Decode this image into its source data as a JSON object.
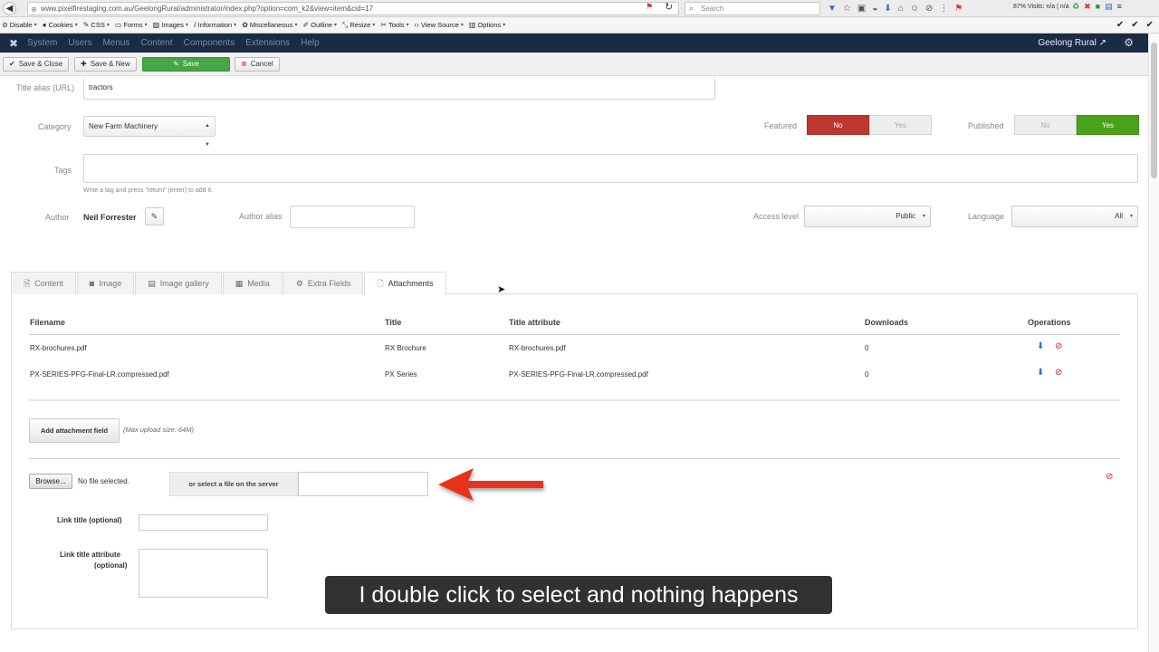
{
  "browser": {
    "url": "www.pixelfirestaging.com.au/GeelongRural/administrator/index.php?option=com_k2&view=item&cid=17",
    "search_placeholder": "Search",
    "visits_text": "87%  Visits: n/a | n/a"
  },
  "dev_toolbar": {
    "items": [
      "Disable",
      "Cookies",
      "CSS",
      "Forms",
      "Images",
      "Information",
      "Miscellaneous",
      "Outline",
      "Resize",
      "Tools",
      "View Source",
      "Options"
    ]
  },
  "admin_nav": {
    "items": [
      "System",
      "Users",
      "Menus",
      "Content",
      "Components",
      "Extensions",
      "Help"
    ],
    "site_link": "Geelong Rural"
  },
  "actions": {
    "save_close": "Save & Close",
    "save_new": "Save & New",
    "save": "Save",
    "cancel": "Cancel"
  },
  "form": {
    "alias_label": "Title alias (URL)",
    "alias_value": "tractors",
    "category_label": "Category",
    "category_value": "New Farm Machinery",
    "featured_label": "Featured",
    "featured_no": "No",
    "featured_yes": "Yes",
    "published_label": "Published",
    "published_no": "No",
    "published_yes": "Yes",
    "tags_label": "Tags",
    "tags_help": "Write a tag and press \"return\" (enter) to add it.",
    "author_label": "Author",
    "author_name": "Neil Forrester",
    "author_alias_label": "Author alias",
    "access_label": "Access level",
    "access_value": "Public",
    "language_label": "Language",
    "language_value": "All"
  },
  "tabs": [
    {
      "label": "Content",
      "icon": "document-icon"
    },
    {
      "label": "Image",
      "icon": "camera-icon"
    },
    {
      "label": "Image gallery",
      "icon": "gallery-icon"
    },
    {
      "label": "Media",
      "icon": "media-icon"
    },
    {
      "label": "Extra Fields",
      "icon": "gear-icon"
    },
    {
      "label": "Attachments",
      "icon": "file-icon"
    }
  ],
  "attachments": {
    "headers": {
      "filename": "Filename",
      "title": "Title",
      "title_attribute": "Title attribute",
      "downloads": "Downloads",
      "operations": "Operations"
    },
    "rows": [
      {
        "filename": "RX-brochures.pdf",
        "title": "RX Brochure",
        "title_attribute": "RX-brochures.pdf",
        "downloads": "0"
      },
      {
        "filename": "PX-SERIES-PFG-Final-LR.compressed.pdf",
        "title": "PX Series",
        "title_attribute": "PX-SERIES-PFG-Final-LR.compressed.pdf",
        "downloads": "0"
      }
    ],
    "add_button": "Add attachment field",
    "max_upload": "(Max upload size: 64M)",
    "browse": "Browse...",
    "no_file": "No file selected.",
    "server_select": "or select a file on the server",
    "link_title_label": "Link title (optional)",
    "link_attr_label_1": "Link title attribute",
    "link_attr_label_2": "(optional)"
  },
  "caption": "I double click to select and nothing happens",
  "colors": {
    "admin_nav": "#1b2b43",
    "save_green": "#46a546",
    "featured_no_red": "#bd362f",
    "published_yes_green": "#49a21b",
    "arrow_red": "#e8321e"
  }
}
